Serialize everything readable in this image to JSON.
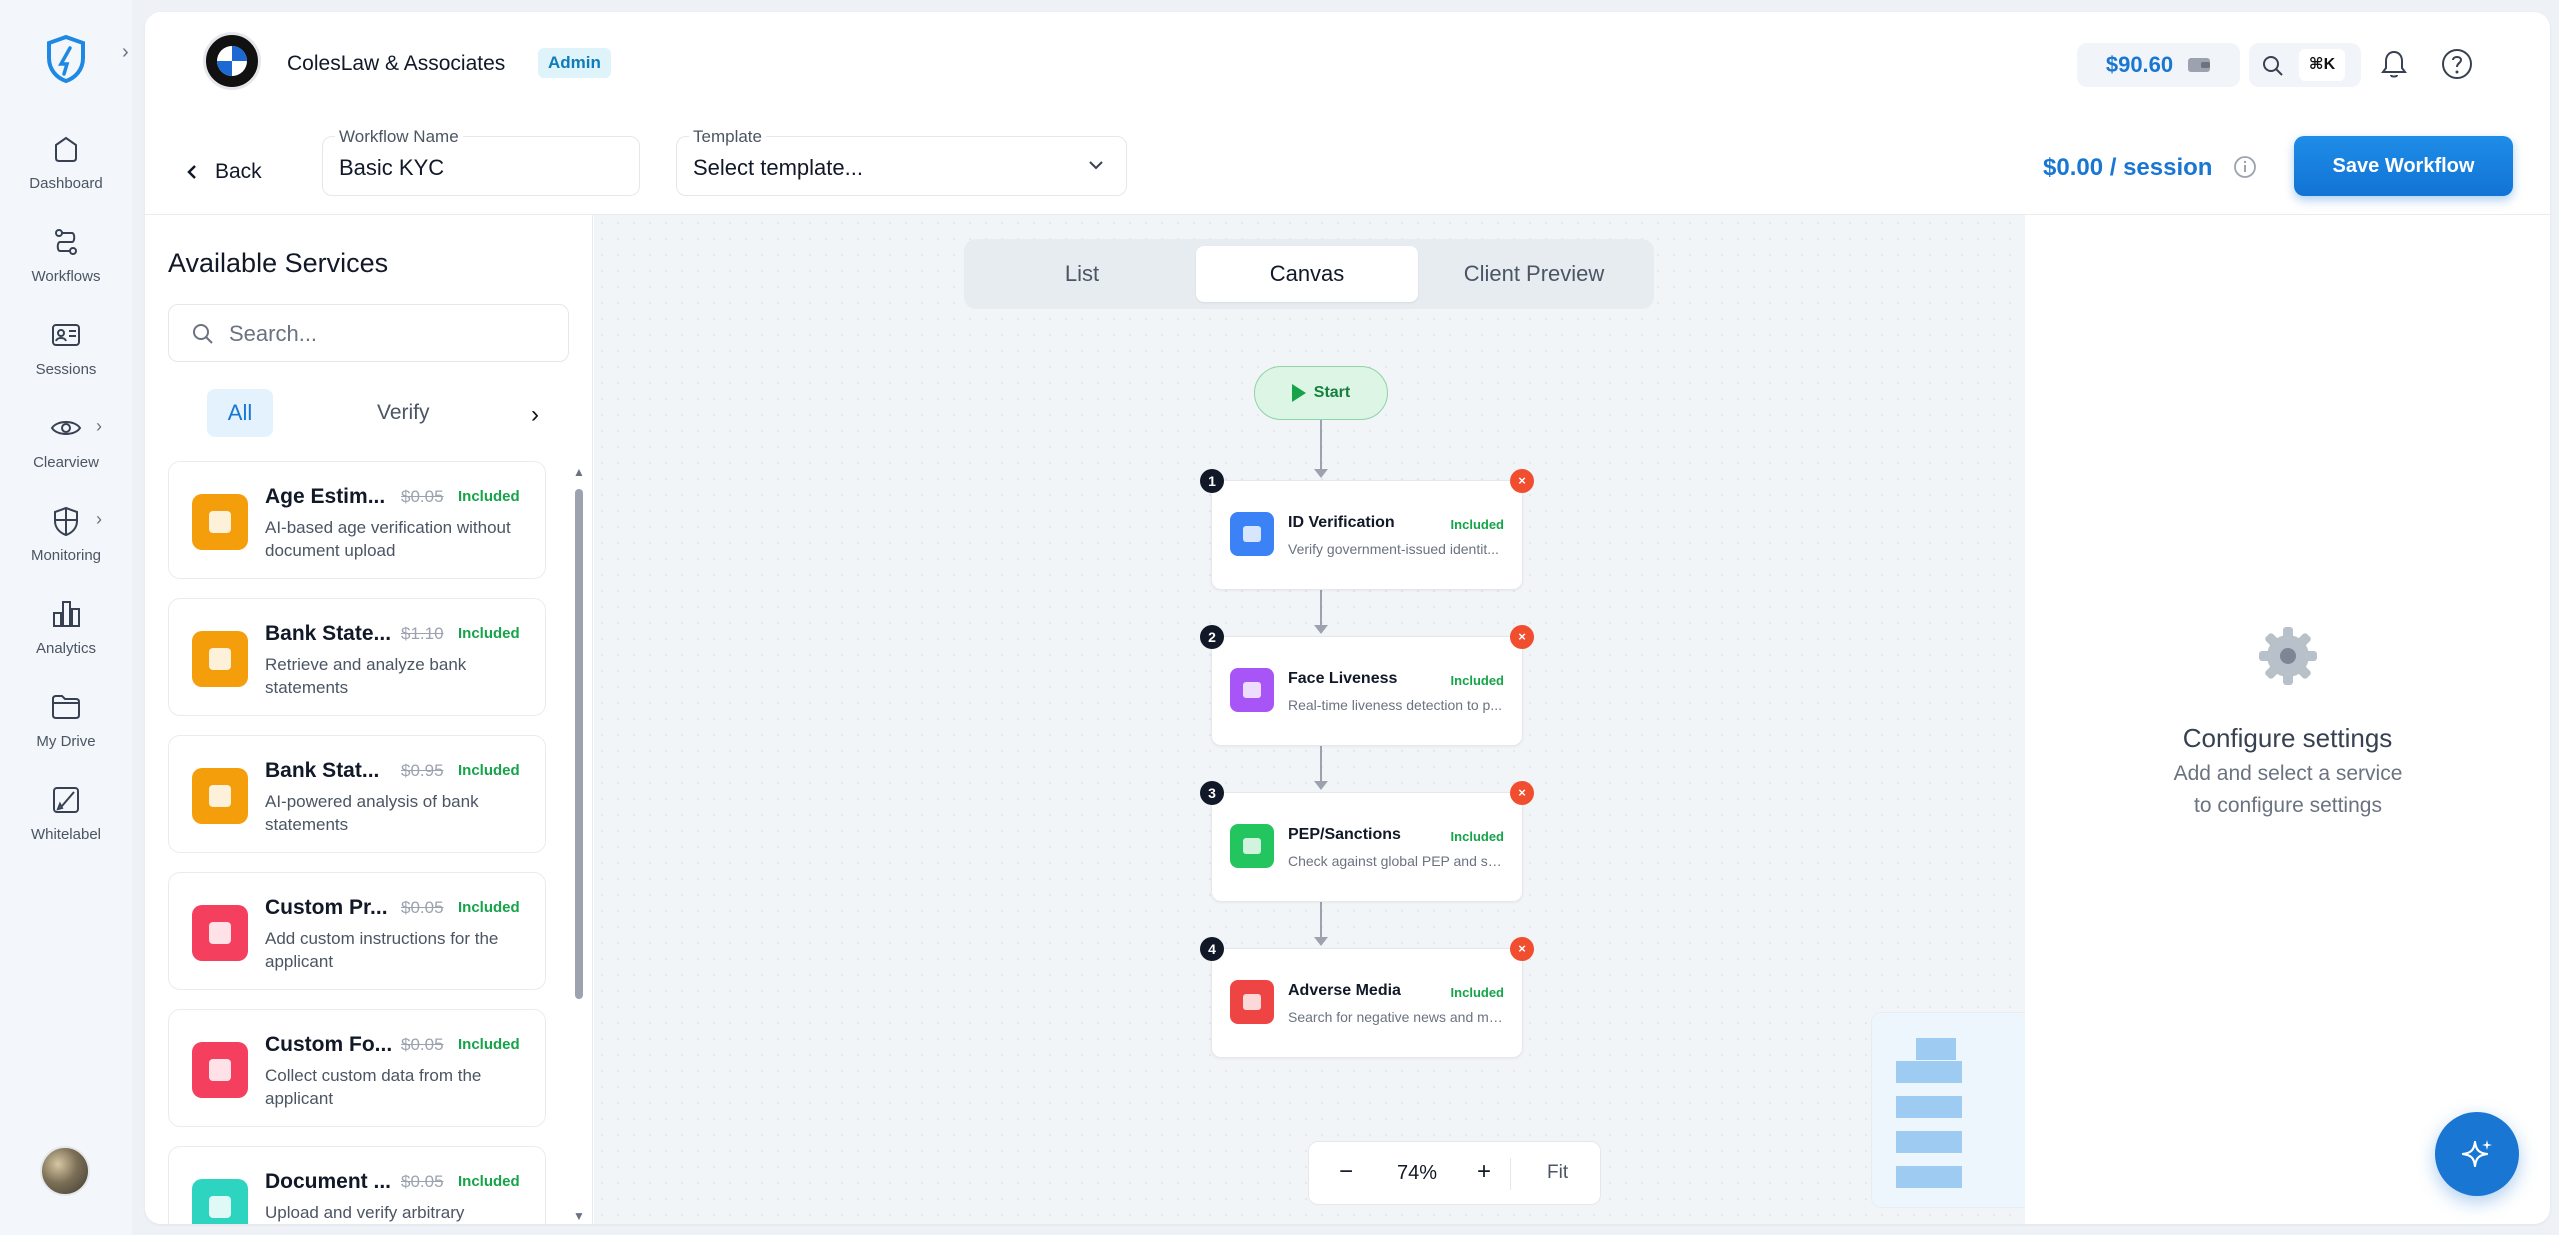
{
  "nav": {
    "items": [
      {
        "label": "Dashboard",
        "icon": "home-icon"
      },
      {
        "label": "Workflows",
        "icon": "workflow-icon"
      },
      {
        "label": "Sessions",
        "icon": "id-card-icon"
      },
      {
        "label": "Clearview",
        "icon": "eye-icon"
      },
      {
        "label": "Monitoring",
        "icon": "shield-icon"
      },
      {
        "label": "Analytics",
        "icon": "bar-chart-icon"
      },
      {
        "label": "My Drive",
        "icon": "folder-icon"
      },
      {
        "label": "Whitelabel",
        "icon": "brush-icon"
      }
    ]
  },
  "header": {
    "company": "ColesLaw & Associates",
    "role_badge": "Admin",
    "balance": "$90.60",
    "shortcut": "⌘K"
  },
  "workflow": {
    "back_label": "Back",
    "name_label": "Workflow Name",
    "name_value": "Basic KYC",
    "template_label": "Template",
    "template_value": "Select template...",
    "price_amount": "$0.00",
    "price_unit": "/ session",
    "save_label": "Save Workflow"
  },
  "services": {
    "title": "Available Services",
    "search_placeholder": "Search...",
    "filters": [
      "All",
      "Verify"
    ],
    "items": [
      {
        "name": "Age Estim...",
        "old_price": "$0.05",
        "status": "Included",
        "desc": "AI-based age verification without document upload",
        "color": "#f59e0b"
      },
      {
        "name": "Bank State...",
        "old_price": "$1.10",
        "status": "Included",
        "desc": "Retrieve and analyze bank statements",
        "color": "#f59e0b"
      },
      {
        "name": "Bank Stat...",
        "old_price": "$0.95",
        "status": "Included",
        "desc": "AI-powered analysis of bank statements",
        "color": "#f59e0b"
      },
      {
        "name": "Custom Pr...",
        "old_price": "$0.05",
        "status": "Included",
        "desc": "Add custom instructions for the applicant",
        "color": "#f43f5e"
      },
      {
        "name": "Custom Fo...",
        "old_price": "$0.05",
        "status": "Included",
        "desc": "Collect custom data from the applicant",
        "color": "#f43f5e"
      },
      {
        "name": "Document ...",
        "old_price": "$0.05",
        "status": "Included",
        "desc": "Upload and verify arbitrary documents",
        "color": "#2dd4bf"
      }
    ]
  },
  "canvas": {
    "tabs": [
      "List",
      "Canvas",
      "Client Preview"
    ],
    "active_tab": "Canvas",
    "start_label": "Start",
    "nodes": [
      {
        "num": "1",
        "title": "ID Verification",
        "status": "Included",
        "desc": "Verify government-issued identit...",
        "color": "#3b82f6"
      },
      {
        "num": "2",
        "title": "Face Liveness",
        "status": "Included",
        "desc": "Real-time liveness detection to p...",
        "color": "#a855f7"
      },
      {
        "num": "3",
        "title": "PEP/Sanctions",
        "status": "Included",
        "desc": "Check against global PEP and sa...",
        "color": "#22c55e"
      },
      {
        "num": "4",
        "title": "Adverse Media",
        "status": "Included",
        "desc": "Search for negative news and me...",
        "color": "#ef4444"
      }
    ],
    "zoom": {
      "minus": "−",
      "value": "74%",
      "plus": "+",
      "fit": "Fit"
    }
  },
  "settings": {
    "title": "Configure settings",
    "subtitle": "Add and select a service to configure settings"
  },
  "colors": {
    "accent": "#1976d2",
    "included": "#16a34a",
    "remove": "#f04e2f"
  }
}
